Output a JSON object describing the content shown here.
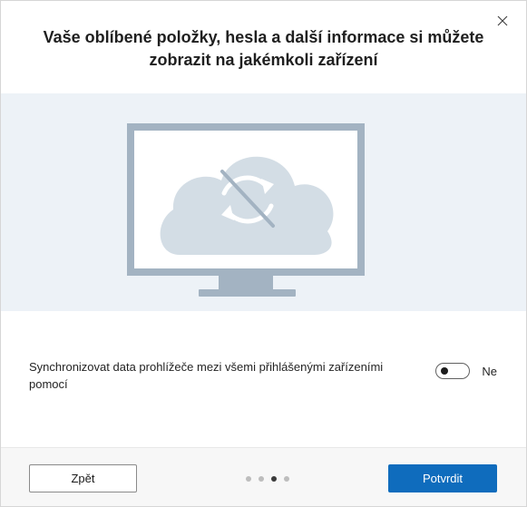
{
  "dialog": {
    "title": "Vaše oblíbené položky, hesla a další informace si můžete zobrazit na jakémkoli zařízení",
    "close_icon": "close-icon"
  },
  "illustration": {
    "icon": "monitor-cloud-sync-off-icon",
    "colors": {
      "background": "#edf2f7",
      "monitor_frame": "#a3b3c2",
      "cloud": "#d3dde5",
      "sync_arrows": "#ffffff",
      "slash": "#a3b3c2"
    }
  },
  "sync": {
    "description": "Synchronizovat data prohlížeče mezi všemi přihlášenými zařízeními pomocí",
    "toggle_state": "off",
    "toggle_label": "Ne"
  },
  "footer": {
    "back_label": "Zpět",
    "confirm_label": "Potvrdit",
    "step_count": 4,
    "active_step": 3,
    "accent_color": "#0f6cbd"
  }
}
